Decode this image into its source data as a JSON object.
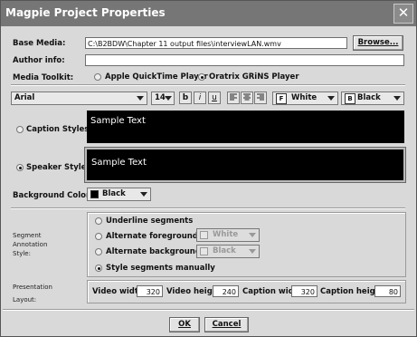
{
  "window": {
    "title": "Magpie Project Properties"
  },
  "base_media": {
    "label": "Base Media:",
    "value": "C:\\B2BDW\\Chapter 11 output files\\interviewLAN.wmv",
    "browse_label": "Browse..."
  },
  "author_info": {
    "label": "Author info:",
    "value": ""
  },
  "media_toolkit": {
    "label": "Media Toolkit:",
    "options": [
      "Apple QuickTime Player",
      "Oratrix GRiNS Player"
    ],
    "selected": "Oratrix GRiNS Player"
  },
  "format_bar": {
    "font": "Arial",
    "size": "14",
    "bold": "b",
    "italic": "i",
    "underline": "u",
    "fg_color_label": "White",
    "fg_color_icon": "F",
    "bg_color_label": "Black",
    "bg_color_icon": "B"
  },
  "caption_styles": {
    "label": "Caption Styles:",
    "sample": "Sample Text"
  },
  "speaker_styles": {
    "label": "Speaker Styles:",
    "sample": "Sample Text"
  },
  "background_color": {
    "label": "Background Color:",
    "value": "Black",
    "swatch": "#000000"
  },
  "segment_annotation": {
    "label_lines": [
      "Segment",
      "Annotation",
      "Style:"
    ],
    "options": [
      "Underline segments",
      "Alternate foreground",
      "Alternate background",
      "Style segments manually"
    ],
    "selected": "Style segments manually",
    "alt_fg_value": "White",
    "alt_bg_value": "Black"
  },
  "presentation_layout": {
    "label_lines": [
      "Presentation",
      "Layout:"
    ],
    "video_width_label": "Video width:",
    "video_width": "320",
    "video_height_label": "Video height:",
    "video_height": "240",
    "caption_width_label": "Caption width:",
    "caption_width": "320",
    "caption_height_label": "Caption height:",
    "caption_height": "80"
  },
  "buttons": {
    "ok": "OK",
    "cancel": "Cancel"
  }
}
